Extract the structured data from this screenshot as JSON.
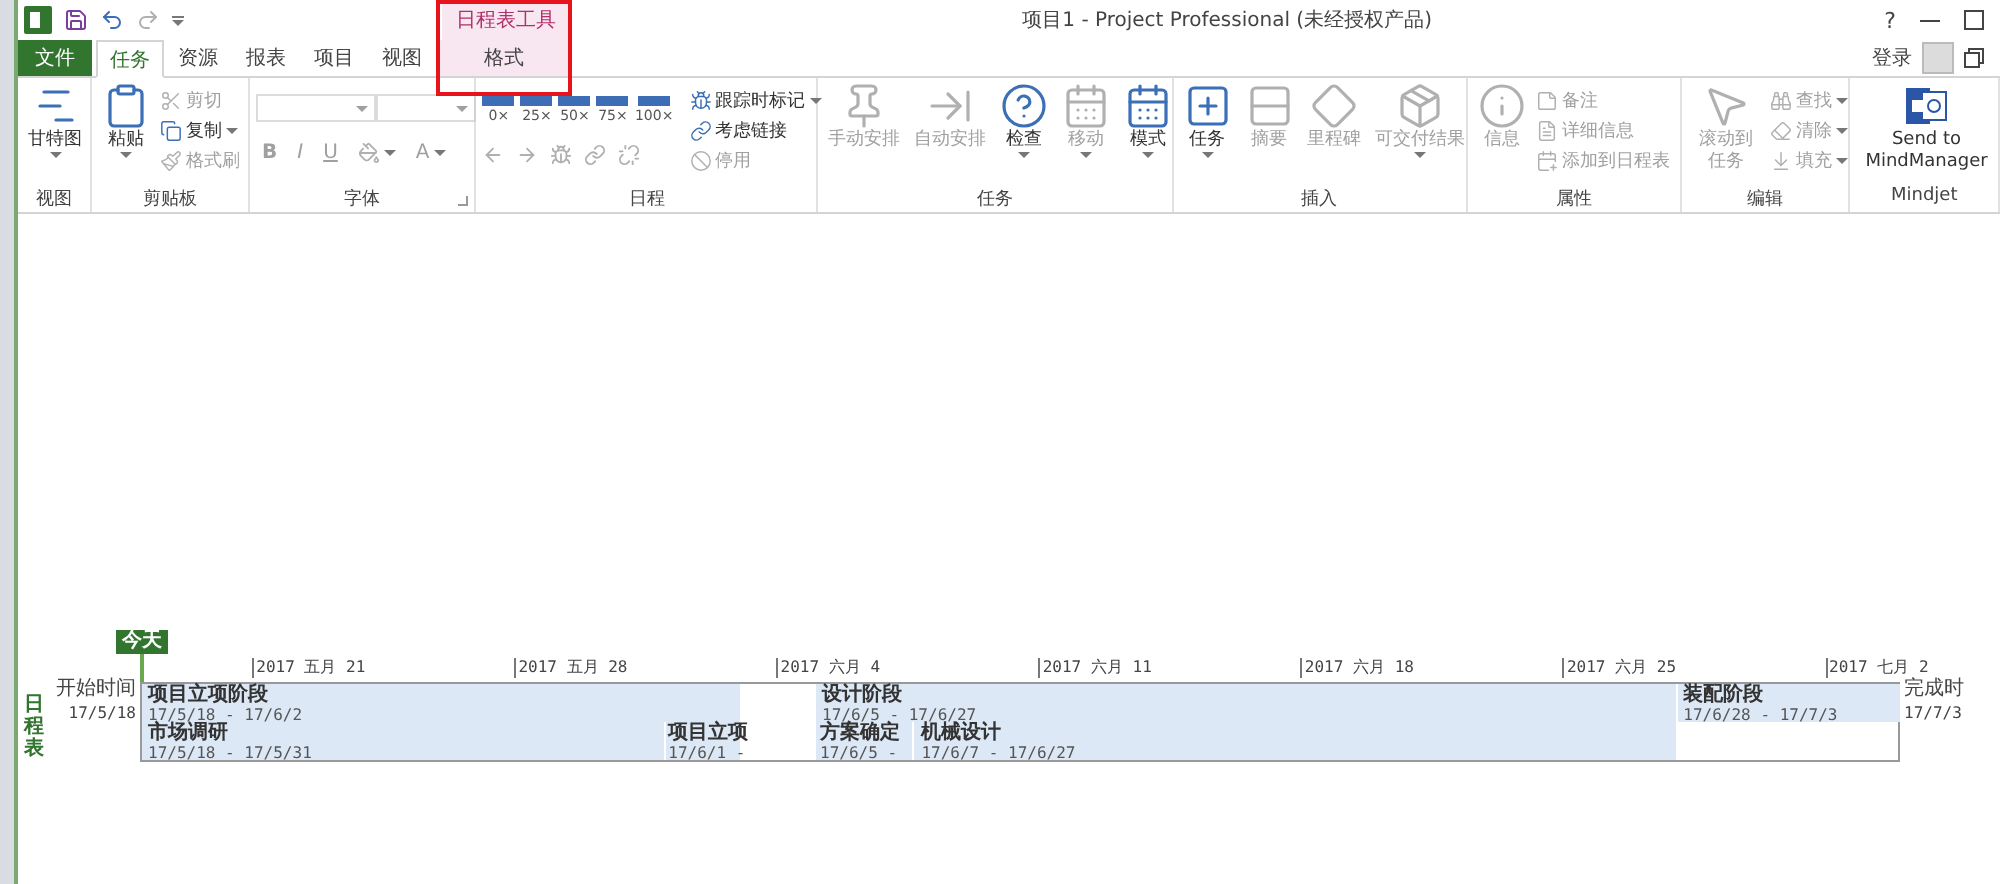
{
  "window": {
    "title": "项目1 - Project Professional (未经授权产品)",
    "help": "?",
    "sign_in": "登录"
  },
  "contextual_header": "日程表工具",
  "tabs": [
    {
      "label": "文件",
      "kind": "file",
      "selected": false
    },
    {
      "label": "任务",
      "kind": "normal",
      "selected": true
    },
    {
      "label": "资源",
      "kind": "normal",
      "selected": false
    },
    {
      "label": "报表",
      "kind": "normal",
      "selected": false
    },
    {
      "label": "项目",
      "kind": "normal",
      "selected": false
    },
    {
      "label": "视图",
      "kind": "normal",
      "selected": false
    },
    {
      "label": "格式",
      "kind": "contextual",
      "selected": false
    }
  ],
  "ribbon": [
    {
      "label": "视图",
      "kind": "standard",
      "items": [
        {
          "kind": "large",
          "label": "甘特图",
          "dropdown": true,
          "disabled": false
        }
      ]
    },
    {
      "label": "剪贴板",
      "kind": "standard",
      "items": [
        {
          "kind": "large",
          "label": "粘贴",
          "dropdown": true,
          "disabled": false
        },
        {
          "kind": "small",
          "label": "剪切",
          "dropdown": false,
          "disabled": true
        },
        {
          "kind": "small",
          "label": "复制",
          "dropdown": true,
          "disabled": false
        },
        {
          "kind": "small",
          "label": "格式刷",
          "dropdown": false,
          "disabled": true
        }
      ]
    },
    {
      "label": "字体",
      "kind": "font",
      "launcher": true,
      "items": [
        {
          "kind": "combo",
          "disabled": true
        },
        {
          "kind": "combo",
          "disabled": true
        },
        {
          "kind": "format",
          "label": "B",
          "dropdown": false,
          "disabled": true
        },
        {
          "kind": "format",
          "label": "I",
          "dropdown": false,
          "disabled": true
        },
        {
          "kind": "format",
          "label": "U",
          "dropdown": false,
          "disabled": true
        },
        {
          "kind": "fill",
          "dropdown": true,
          "disabled": true
        },
        {
          "kind": "format",
          "label": "A",
          "dropdown": true,
          "disabled": true
        }
      ]
    },
    {
      "label": "日程",
      "kind": "schedule",
      "items": [
        {
          "kind": "zoom",
          "label": "0×"
        },
        {
          "kind": "zoom",
          "label": "25×"
        },
        {
          "kind": "zoom",
          "label": "50×"
        },
        {
          "kind": "zoom",
          "label": "75×"
        },
        {
          "kind": "zoom",
          "label": "100×"
        },
        {
          "kind": "small",
          "label": "跟踪时标记",
          "dropdown": true,
          "disabled": false
        },
        {
          "kind": "small",
          "label": "考虑链接",
          "dropdown": false,
          "disabled": false
        },
        {
          "kind": "small",
          "label": "停用",
          "dropdown": false,
          "disabled": true
        }
      ]
    },
    {
      "label": "任务",
      "kind": "standard",
      "items": [
        {
          "kind": "large",
          "label": "手动安排",
          "dropdown": false,
          "disabled": true
        },
        {
          "kind": "large",
          "label": "自动安排",
          "dropdown": false,
          "disabled": true
        },
        {
          "kind": "large",
          "label": "检查",
          "dropdown": true,
          "disabled": false
        },
        {
          "kind": "large",
          "label": "移动",
          "dropdown": true,
          "disabled": true
        },
        {
          "kind": "large",
          "label": "模式",
          "dropdown": true,
          "disabled": false
        }
      ]
    },
    {
      "label": "插入",
      "kind": "standard",
      "items": [
        {
          "kind": "large",
          "label": "任务",
          "dropdown": true,
          "disabled": false
        },
        {
          "kind": "large",
          "label": "摘要",
          "dropdown": false,
          "disabled": true
        },
        {
          "kind": "large",
          "label": "里程碑",
          "dropdown": false,
          "disabled": true
        },
        {
          "kind": "large",
          "label": "可交付结果",
          "dropdown": true,
          "disabled": true
        }
      ]
    },
    {
      "label": "属性",
      "kind": "standard",
      "items": [
        {
          "kind": "large",
          "label": "信息",
          "dropdown": false,
          "disabled": true
        },
        {
          "kind": "small",
          "label": "备注",
          "dropdown": false,
          "disabled": true
        },
        {
          "kind": "small",
          "label": "详细信息",
          "dropdown": false,
          "disabled": true
        },
        {
          "kind": "small",
          "label": "添加到日程表",
          "dropdown": false,
          "disabled": true
        }
      ]
    },
    {
      "label": "编辑",
      "kind": "standard",
      "items": [
        {
          "kind": "large",
          "label": "滚动到任务",
          "dropdown": false,
          "disabled": true
        },
        {
          "kind": "small",
          "label": "查找",
          "dropdown": true,
          "disabled": true
        },
        {
          "kind": "small",
          "label": "清除",
          "dropdown": true,
          "disabled": true
        },
        {
          "kind": "small",
          "label": "填充",
          "dropdown": true,
          "disabled": true
        }
      ]
    },
    {
      "label": "Mindjet",
      "kind": "standard",
      "items": [
        {
          "kind": "large",
          "label": "Send to MindManager",
          "dropdown": false,
          "disabled": false
        }
      ]
    }
  ],
  "timeline": {
    "side_label": "日程表",
    "today": "今天",
    "start": {
      "label": "开始时间",
      "date": "17/5/18"
    },
    "finish": {
      "label": "完成时",
      "date": "17/7/3"
    },
    "scale": [
      "2017 五月 21",
      "2017 五月 28",
      "2017 六月 4",
      "2017 六月 11",
      "2017 六月 18",
      "2017 六月 25",
      "2017 七月 2"
    ],
    "tasks": [
      {
        "kind": "phase",
        "name": "项目立项阶段",
        "dates": "17/5/18 - 17/6/2"
      },
      {
        "kind": "phase",
        "name": "设计阶段",
        "dates": "17/6/5 - 17/6/27"
      },
      {
        "kind": "phase",
        "name": "装配阶段",
        "dates": "17/6/28 - 17/7/3"
      },
      {
        "kind": "task",
        "name": "市场调研",
        "dates": "17/5/18 - 17/5/31"
      },
      {
        "kind": "task",
        "name": "项目立项",
        "dates": "17/6/1 -"
      },
      {
        "kind": "task",
        "name": "方案确定",
        "dates": "17/6/5 -"
      },
      {
        "kind": "task",
        "name": "机械设计",
        "dates": "17/6/7 - 17/6/27"
      }
    ]
  }
}
